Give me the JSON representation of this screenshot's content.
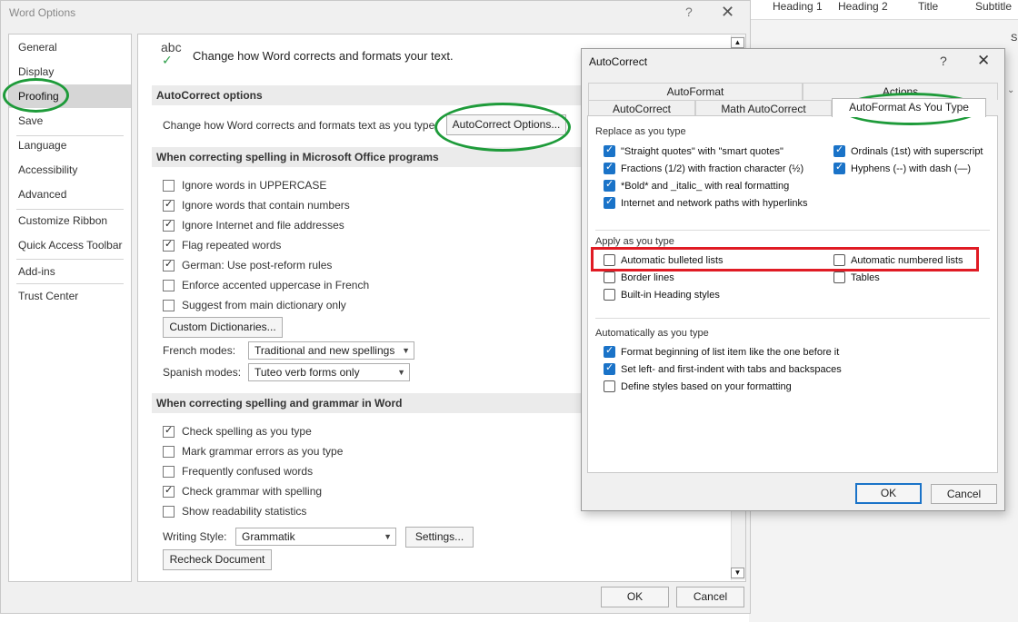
{
  "word_ribbon": {
    "styles": [
      "Heading 1",
      "Heading 2",
      "Title",
      "Subtitle"
    ],
    "partial_letter": "S",
    "expander_glyph": "⌄"
  },
  "word_options": {
    "title": "Word Options",
    "help_glyph": "?",
    "close_glyph": "✕",
    "nav": [
      "General",
      "Display",
      "Proofing",
      "Save",
      "Language",
      "Accessibility",
      "Advanced",
      "Customize Ribbon",
      "Quick Access Toolbar",
      "Add-ins",
      "Trust Center"
    ],
    "selected_nav": "Proofing",
    "header": {
      "icon_text": "abc",
      "icon_check": "✓",
      "text": "Change how Word corrects and formats your text."
    },
    "autocorrect_section": {
      "title": "AutoCorrect options",
      "description": "Change how Word corrects and formats text as you type:",
      "button": "AutoCorrect Options..."
    },
    "office_spelling_section": {
      "title": "When correcting spelling in Microsoft Office programs",
      "options": [
        {
          "label": "Ignore words in UPPERCASE",
          "checked": false
        },
        {
          "label": "Ignore words that contain numbers",
          "checked": true
        },
        {
          "label": "Ignore Internet and file addresses",
          "checked": true
        },
        {
          "label": "Flag repeated words",
          "checked": true
        },
        {
          "label": "German: Use post-reform rules",
          "checked": true
        },
        {
          "label": "Enforce accented uppercase in French",
          "checked": false
        },
        {
          "label": "Suggest from main dictionary only",
          "checked": false
        }
      ],
      "custom_dictionaries_button": "Custom Dictionaries...",
      "french_modes_label": "French modes:",
      "french_modes_value": "Traditional and new spellings",
      "spanish_modes_label": "Spanish modes:",
      "spanish_modes_value": "Tuteo verb forms only"
    },
    "word_grammar_section": {
      "title": "When correcting spelling and grammar in Word",
      "options": [
        {
          "label": "Check spelling as you type",
          "checked": true
        },
        {
          "label": "Mark grammar errors as you type",
          "checked": false
        },
        {
          "label": "Frequently confused words",
          "checked": false
        },
        {
          "label": "Check grammar with spelling",
          "checked": true
        },
        {
          "label": "Show readability statistics",
          "checked": false
        }
      ],
      "writing_style_label": "Writing Style:",
      "writing_style_value": "Grammatik",
      "settings_button": "Settings...",
      "recheck_button": "Recheck Document"
    },
    "ok_button": "OK",
    "cancel_button": "Cancel",
    "scroll_up": "▲",
    "scroll_down": "▼",
    "chevron": "▼"
  },
  "autocorrect": {
    "title": "AutoCorrect",
    "help_glyph": "?",
    "close_glyph": "✕",
    "tabs_back": [
      "AutoFormat",
      "Actions"
    ],
    "tabs_front": [
      "AutoCorrect",
      "Math AutoCorrect",
      "AutoFormat As You Type"
    ],
    "active_tab": "AutoFormat As You Type",
    "replace_group": {
      "title": "Replace as you type",
      "options": [
        {
          "label": "\"Straight quotes\" with \"smart quotes\"",
          "checked": true
        },
        {
          "label": "Ordinals (1st) with superscript",
          "checked": true
        },
        {
          "label": "Fractions (1/2) with fraction character (½)",
          "checked": true
        },
        {
          "label": "Hyphens (--) with dash (—)",
          "checked": true
        },
        {
          "label": "*Bold* and _italic_ with real formatting",
          "checked": true
        },
        {
          "label": "Internet and network paths with hyperlinks",
          "checked": true
        }
      ]
    },
    "apply_group": {
      "title": "Apply as you type",
      "options": [
        {
          "label": "Automatic bulleted lists",
          "checked": false
        },
        {
          "label": "Automatic numbered lists",
          "checked": false
        },
        {
          "label": "Border lines",
          "checked": false
        },
        {
          "label": "Tables",
          "checked": false
        },
        {
          "label": "Built-in Heading styles",
          "checked": false
        }
      ]
    },
    "auto_group": {
      "title": "Automatically as you type",
      "options": [
        {
          "label": "Format beginning of list item like the one before it",
          "checked": true
        },
        {
          "label": "Set left- and first-indent with tabs and backspaces",
          "checked": true
        },
        {
          "label": "Define styles based on your formatting",
          "checked": false
        }
      ]
    },
    "ok_button": "OK",
    "cancel_button": "Cancel"
  },
  "colors": {
    "annotation_green": "#1e9b3a",
    "annotation_red": "#e01b24",
    "checkbox_blue": "#1a73c8",
    "nav_selected": "#d6d6d6"
  }
}
